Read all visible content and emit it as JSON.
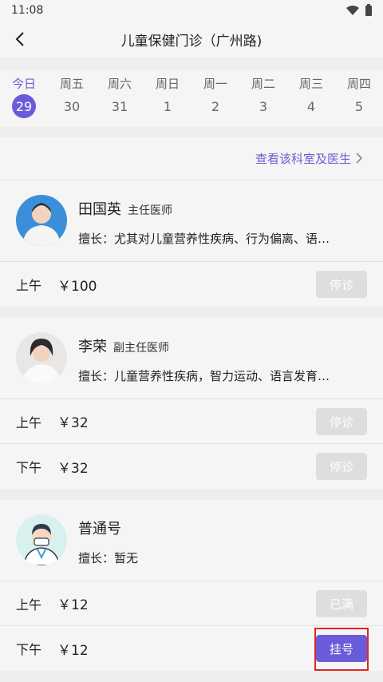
{
  "status": {
    "time": "11:08"
  },
  "header": {
    "title": "儿童保健门诊（广州路)"
  },
  "dates": [
    {
      "dow": "今日",
      "day": "29",
      "active": true
    },
    {
      "dow": "周五",
      "day": "30"
    },
    {
      "dow": "周六",
      "day": "31"
    },
    {
      "dow": "周日",
      "day": "1"
    },
    {
      "dow": "周一",
      "day": "2"
    },
    {
      "dow": "周二",
      "day": "3"
    },
    {
      "dow": "周三",
      "day": "4"
    },
    {
      "dow": "周四",
      "day": "5"
    }
  ],
  "dept_link": "查看该科室及医生",
  "doctors": [
    {
      "name": "田国英",
      "title": "主任医师",
      "spec": "擅长：尤其对儿童营养性疾病、行为偏离、语…",
      "slots": [
        {
          "period": "上午",
          "price": "￥100",
          "button": "停诊"
        }
      ]
    },
    {
      "name": "李荣",
      "title": "副主任医师",
      "spec": "擅长：儿童营养性疾病，智力运动、语言发育…",
      "slots": [
        {
          "period": "上午",
          "price": "￥32",
          "button": "停诊"
        },
        {
          "period": "下午",
          "price": "￥32",
          "button": "停诊"
        }
      ]
    },
    {
      "name": "普通号",
      "title": "",
      "spec": "擅长：暂无",
      "slots": [
        {
          "period": "上午",
          "price": "￥12",
          "button": "已满"
        },
        {
          "period": "下午",
          "price": "￥12",
          "button": "挂号"
        }
      ]
    }
  ],
  "colors": {
    "accent": "#6a5cd8",
    "disabled": "#dedede",
    "highlight": "#e02424"
  }
}
